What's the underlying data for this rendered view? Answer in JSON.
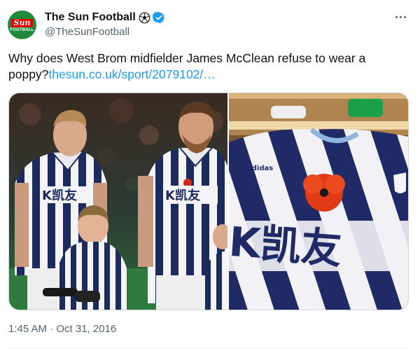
{
  "account": {
    "display_name": "The Sun Football",
    "handle": "@TheSunFootball",
    "avatar_logo_top": "Sun",
    "avatar_logo_bottom": "FOOTBALL"
  },
  "tweet": {
    "text": "Why does West Brom midfielder James McClean refuse to wear a poppy?",
    "link_text": "thesun.co.uk/sport/2079102/…",
    "timestamp": "1:45 AM · Oct 31, 2016"
  },
  "media": {
    "left_photo": {
      "shirt_sponsor_1": "K凯友",
      "shirt_sponsor_2": "K凯友"
    },
    "right_photo": {
      "shirt_sponsor": "K凯友",
      "kit_brand": "adidas"
    }
  },
  "icons": [
    "football-icon",
    "verified-icon",
    "more-icon"
  ],
  "colors": {
    "link": "#1d9bf0",
    "verified": "#1d9bf0",
    "secondary_text": "#536471",
    "brand_red": "#e10000",
    "brand_green": "#1f8a3b"
  }
}
